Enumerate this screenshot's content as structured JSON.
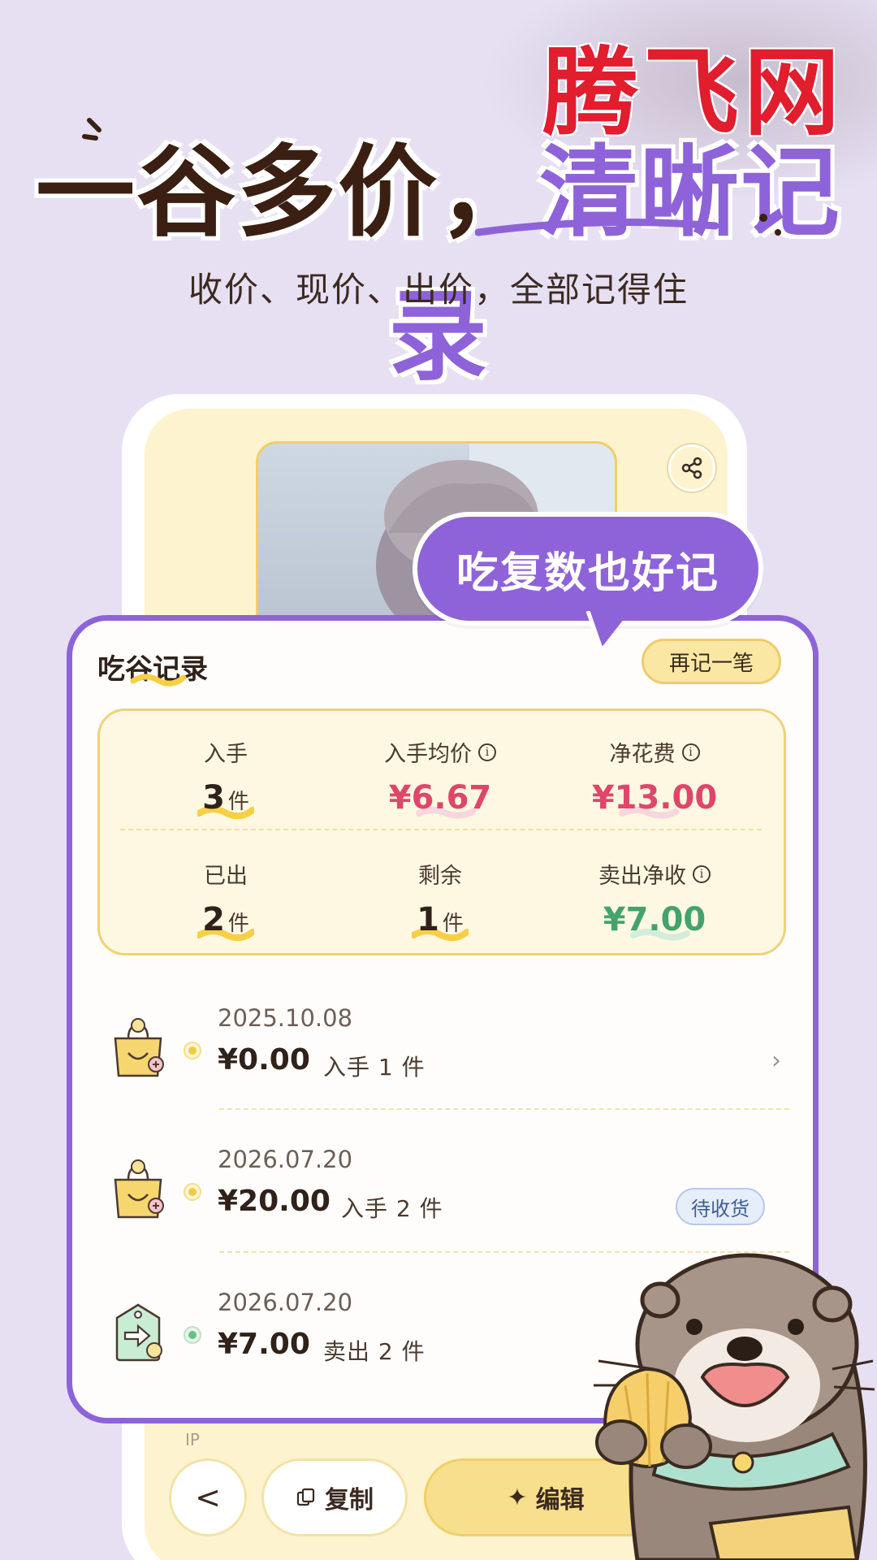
{
  "watermark": "腾飞网",
  "headline": {
    "left": "一谷多价，",
    "right": "清晰记录"
  },
  "subtitle": "收价、现价、出价，全部记得住",
  "bubble": "吃复数也好记",
  "card": {
    "title": "吃谷记录",
    "again_button": "再记一笔",
    "stats": {
      "acquired": {
        "label": "入手",
        "value": "3",
        "unit": "件"
      },
      "avg_price": {
        "label": "入手均价",
        "value": "¥6.67"
      },
      "net_spend": {
        "label": "净花费",
        "value": "¥13.00"
      },
      "sold": {
        "label": "已出",
        "value": "2",
        "unit": "件"
      },
      "remaining": {
        "label": "剩余",
        "value": "1",
        "unit": "件"
      },
      "sold_net": {
        "label": "卖出净收",
        "value": "¥7.00"
      }
    },
    "records": [
      {
        "date": "2025.10.08",
        "amount": "¥0.00",
        "desc": "入手 1 件",
        "icon": "shopping-bag-icon"
      },
      {
        "date": "2026.07.20",
        "amount": "¥20.00",
        "desc": "入手 2 件",
        "icon": "shopping-bag-icon",
        "badge": "待收货"
      },
      {
        "date": "2026.07.20",
        "amount": "¥7.00",
        "desc": "卖出 2 件",
        "icon": "sell-tag-icon"
      }
    ]
  },
  "phone": {
    "ip_label": "IP",
    "back_button": "<",
    "copy_button": "复制",
    "edit_button": "编辑"
  },
  "colors": {
    "background": "#e7e0f3",
    "accent_purple": "#8e63d9",
    "price_red": "#e0456a",
    "price_green": "#43a36b",
    "card_yellow": "#fef8e2"
  }
}
